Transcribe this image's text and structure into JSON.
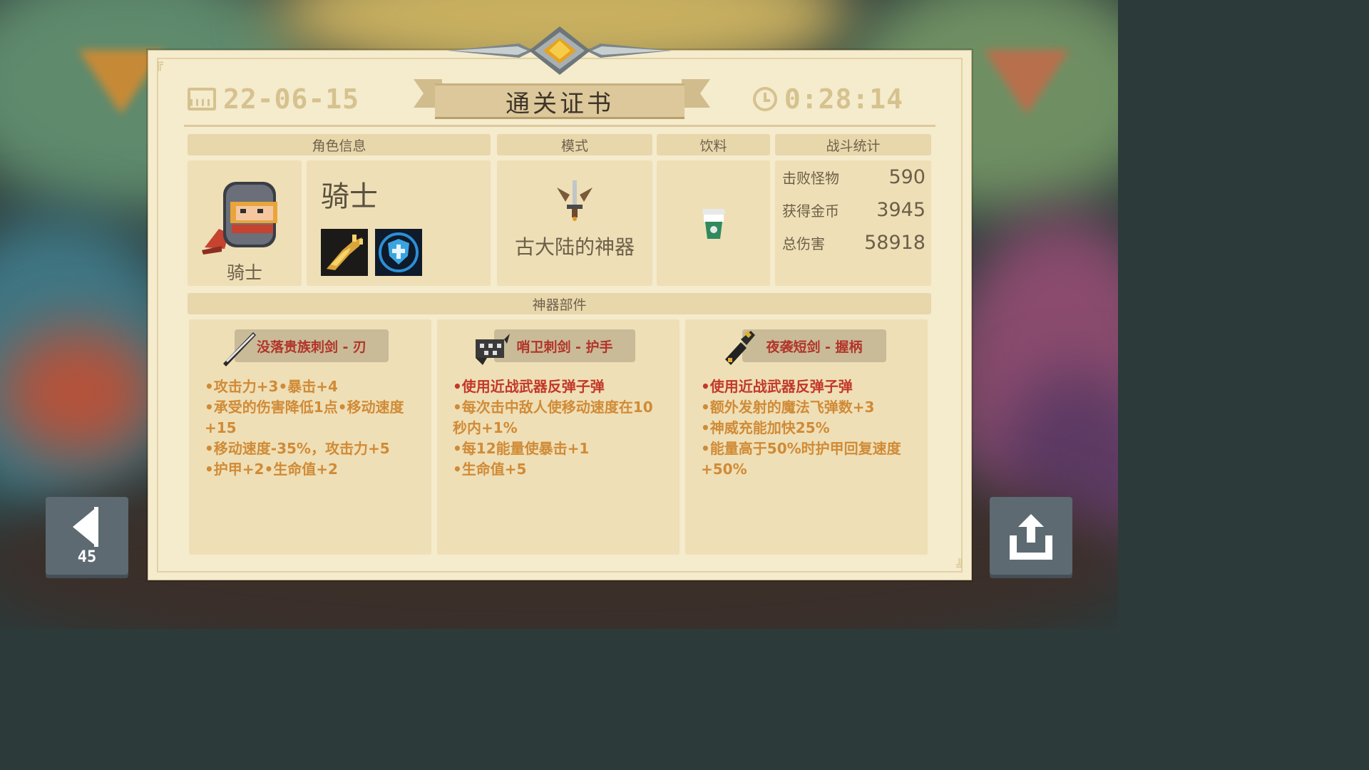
{
  "certificate": {
    "title": "通关证书",
    "date": "22-06-15",
    "time": "0:28:14"
  },
  "headers": {
    "character": "角色信息",
    "mode": "模式",
    "drink": "饮料",
    "stats": "战斗统计",
    "parts": "神器部件"
  },
  "character": {
    "name": "骑士",
    "caption": "骑士",
    "portrait_icon": "knight-helmet-icon",
    "skills": [
      "golden-gun-icon",
      "blue-shield-icon"
    ]
  },
  "mode": {
    "label": "古大陆的神器",
    "icon": "artifact-sword-wings-icon"
  },
  "drink": {
    "icon": "green-cup-icon"
  },
  "stats": [
    {
      "label": "击败怪物",
      "value": "590"
    },
    {
      "label": "获得金币",
      "value": "3945"
    },
    {
      "label": "总伤害",
      "value": "58918"
    }
  ],
  "parts": [
    {
      "name": "没落贵族刺剑 - 刃",
      "icon": "rapier-blade-icon",
      "lines": [
        {
          "text": "•攻击力+3•暴击+4",
          "red": false
        },
        {
          "text": "•承受的伤害降低1点•移动速度+15",
          "red": false
        },
        {
          "text": "•移动速度-35%，攻击力+5",
          "red": false
        },
        {
          "text": "•护甲+2•生命值+2",
          "red": false
        }
      ]
    },
    {
      "name": "哨卫刺剑 - 护手",
      "icon": "sentinel-guard-icon",
      "lines": [
        {
          "text": "•使用近战武器反弹子弹",
          "red": true
        },
        {
          "text": "•每次击中敌人使移动速度在10秒内+1%",
          "red": false
        },
        {
          "text": "•每12能量使暴击+1",
          "red": false
        },
        {
          "text": "•生命值+5",
          "red": false
        }
      ]
    },
    {
      "name": "夜袭短剑 - 握柄",
      "icon": "night-dagger-hilt-icon",
      "lines": [
        {
          "text": "•使用近战武器反弹子弹",
          "red": true
        },
        {
          "text": "•额外发射的魔法飞弹数+3",
          "red": false
        },
        {
          "text": "•神威充能加快25%",
          "red": false
        },
        {
          "text": "•能量高于50%时护甲回复速度+50%",
          "red": false
        }
      ]
    }
  ],
  "buttons": {
    "back_count": "45",
    "back_icon": "back-arrow-icon",
    "share_icon": "share-icon"
  },
  "colors": {
    "paper": "#f5ebcd",
    "panel": "#efdfb6",
    "header": "#e8d7ab",
    "accent_orange": "#d08b37",
    "accent_red": "#c2392a"
  }
}
